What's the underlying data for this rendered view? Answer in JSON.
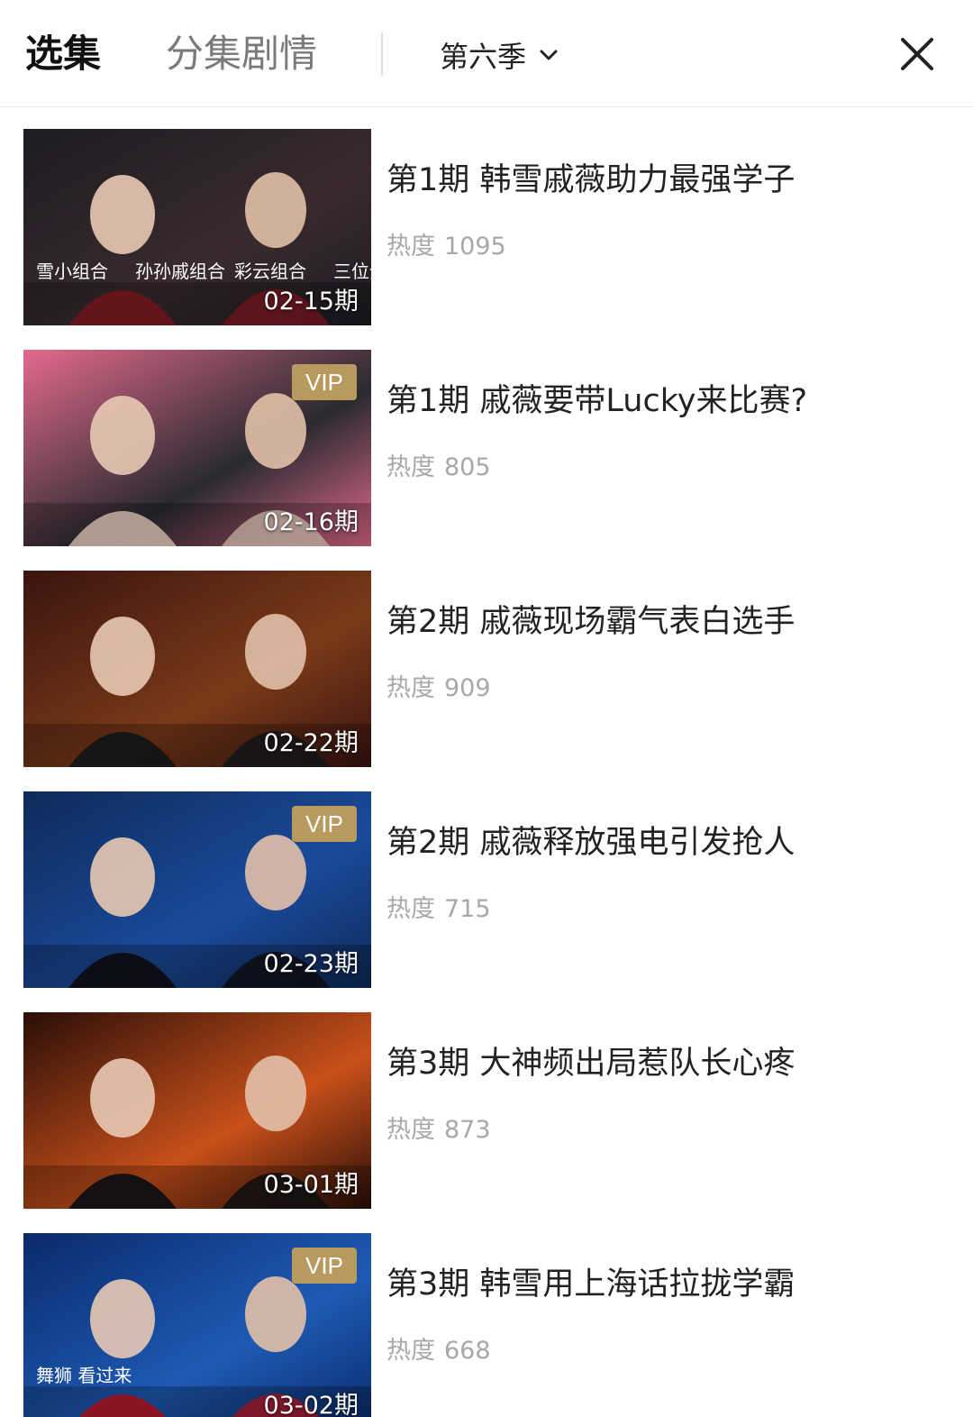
{
  "header": {
    "tab_episodes": "选集",
    "tab_plot": "分集剧情",
    "season_label": "第六季",
    "chevron_icon": "chevron-down-icon",
    "close_icon": "close-icon"
  },
  "episodes": [
    {
      "title": "第1期 韩雪戚薇助力最强学子",
      "heat_label": "热度",
      "heat": "1095",
      "date": "02-15期",
      "vip": "",
      "thumb_palette": [
        "#1c1c22",
        "#3a2a2e",
        "#8a1a24"
      ],
      "thumb_overlay_text": [
        "雪小组合",
        "孙孙戚组合",
        "彩云组合",
        "三位全能艺人"
      ]
    },
    {
      "title": "第1期 戚薇要带Lucky来比赛?",
      "heat_label": "热度",
      "heat": "805",
      "date": "02-16期",
      "vip": "VIP",
      "thumb_palette": [
        "#e36a8c",
        "#2a2a30",
        "#f3d8c8"
      ],
      "thumb_overlay_text": []
    },
    {
      "title": "第2期 戚薇现场霸气表白选手",
      "heat_label": "热度",
      "heat": "909",
      "date": "02-22期",
      "vip": "",
      "thumb_palette": [
        "#3a1410",
        "#7a3a18",
        "#1a1a1e"
      ],
      "thumb_overlay_text": []
    },
    {
      "title": "第2期 戚薇释放强电引发抢人",
      "heat_label": "热度",
      "heat": "715",
      "date": "02-23期",
      "vip": "VIP",
      "thumb_palette": [
        "#0e2a5a",
        "#1a4a9a",
        "#101018"
      ],
      "thumb_overlay_text": []
    },
    {
      "title": "第3期 大神频出局惹队长心疼",
      "heat_label": "热度",
      "heat": "873",
      "date": "03-01期",
      "vip": "",
      "thumb_palette": [
        "#2a0e08",
        "#c8501a",
        "#141418"
      ],
      "thumb_overlay_text": []
    },
    {
      "title": "第3期 韩雪用上海话拉拢学霸",
      "heat_label": "热度",
      "heat": "668",
      "date": "03-02期",
      "vip": "VIP",
      "thumb_palette": [
        "#0a2a6a",
        "#1e5ab4",
        "#c01a2a"
      ],
      "thumb_overlay_text": [
        "舞狮 看过来"
      ]
    }
  ]
}
